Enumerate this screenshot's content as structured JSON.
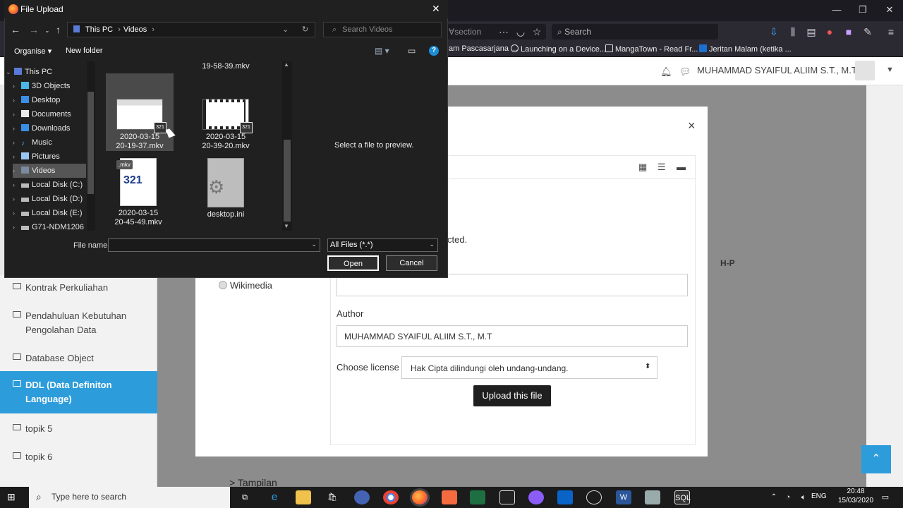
{
  "browser": {
    "tab_tail": "Ɐsection",
    "search_placeholder": "Search",
    "min": "—",
    "max": "❐",
    "close": "✕",
    "bookmarks": [
      "am Pascasarjana ...",
      "Launching on a Device...",
      "MangaTown - Read Fr...",
      "Jeritan Malam (ketika ..."
    ]
  },
  "moodle": {
    "user_name": "MUHAMMAD SYAIFUL ALIIM S.T., M.T",
    "nav_items": [
      "Kontrak Perkuliahan",
      "Pendahuluan Kebutuhan Pengolahan Data",
      "Database Object",
      "DDL (Data Definiton Language)",
      "topik 5",
      "topik 6"
    ],
    "active_nav": "DDL (Data Definiton Language)",
    "modal": {
      "close": "×",
      "selected_tail": "cted.",
      "repository": "Wikimedia",
      "author_label": "Author",
      "author_value": "MUHAMMAD SYAIFUL ALIIM S.T., M.T",
      "license_label": "Choose license",
      "license_value": "Hak Cipta dilindungi oleh undang-undang.",
      "upload_label": "Upload this file"
    },
    "editor_hint": "H-P",
    "bottom_peek": "Tampilan"
  },
  "dialog": {
    "title": "File Upload",
    "path": [
      "This PC",
      "Videos"
    ],
    "search_placeholder": "Search Videos",
    "organise": "Organise",
    "new_folder": "New folder",
    "tree": [
      "This PC",
      "3D Objects",
      "Desktop",
      "Documents",
      "Downloads",
      "Music",
      "Pictures",
      "Videos",
      "Local Disk (C:)",
      "Local Disk (D:)",
      "Local Disk (E:)",
      "G71-NDM1206 ("
    ],
    "files": [
      {
        "name": "19-58-39.mkv"
      },
      {
        "date": "2020-03-15",
        "time": "20-19-37.mkv"
      },
      {
        "date": "2020-03-15",
        "time": "20-39-20.mkv"
      },
      {
        "date": "2020-03-15",
        "time": "20-45-49.mkv",
        "tag": ".mkv"
      },
      {
        "name": "desktop.ini"
      }
    ],
    "preview": "Select a file to preview.",
    "filename_label": "File name:",
    "filetype": "All Files (*.*)",
    "open": "Open",
    "cancel": "Cancel"
  },
  "taskbar": {
    "search_placeholder": "Type here to search",
    "lang": "ENG",
    "time": "20:48",
    "date": "15/03/2020"
  }
}
